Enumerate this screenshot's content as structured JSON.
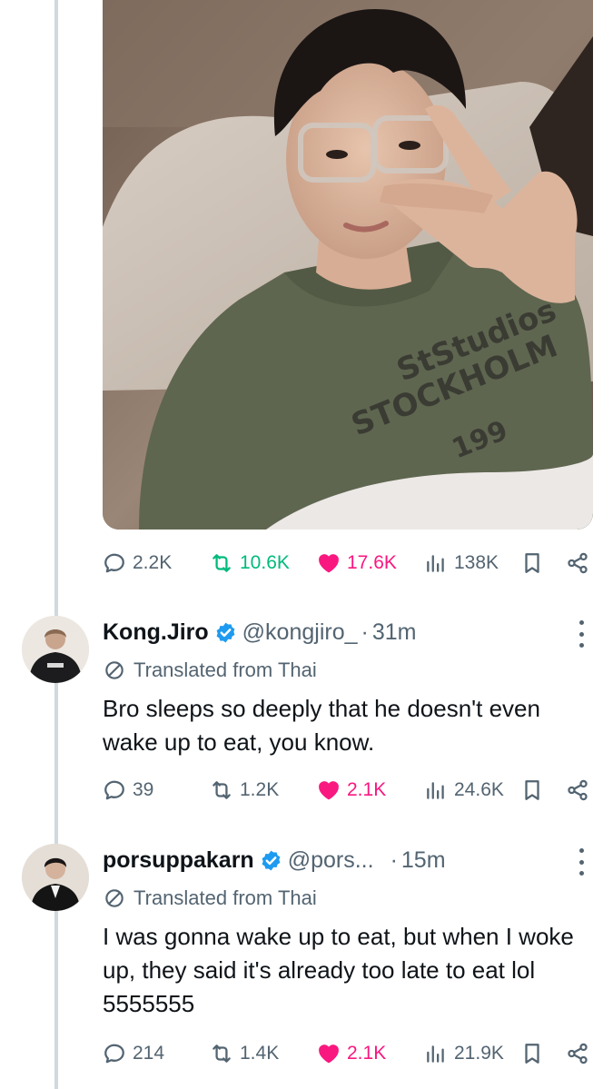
{
  "main_post": {
    "stats": {
      "replies": "2.2K",
      "reposts": "10.6K",
      "likes": "17.6K",
      "views": "138K"
    }
  },
  "photo": {
    "shirt_text_1": "StStudios",
    "shirt_text_2": "STOCKHOLM",
    "shirt_text_3": "199"
  },
  "replies": [
    {
      "name": "Kong.Jiro",
      "handle": "@kongjiro_",
      "separator": "·",
      "time": "31m",
      "translated_label": "Translated from Thai",
      "text": "Bro sleeps so deeply that he doesn't even wake up to eat, you know.",
      "stats": {
        "replies": "39",
        "reposts": "1.2K",
        "likes": "2.1K",
        "views": "24.6K"
      }
    },
    {
      "name": "porsuppakarn",
      "handle": "@pors...",
      "separator": "·",
      "time": "15m",
      "translated_label": "Translated from Thai",
      "text": "I was gonna wake up to eat, but when I woke up, they said it's already too late to eat lol 5555555",
      "stats": {
        "replies": "214",
        "reposts": "1.4K",
        "likes": "2.1K",
        "views": "21.9K"
      }
    }
  ],
  "colors": {
    "text_secondary": "#536471",
    "like": "#f91880",
    "repost_active": "#00ba7c",
    "verified": "#1d9bf0",
    "thread_line": "#cfd9de"
  },
  "icons": [
    "reply-icon",
    "repost-icon",
    "like-icon",
    "views-icon",
    "bookmark-icon",
    "share-icon",
    "verified-badge-icon",
    "more-icon",
    "translate-icon"
  ]
}
